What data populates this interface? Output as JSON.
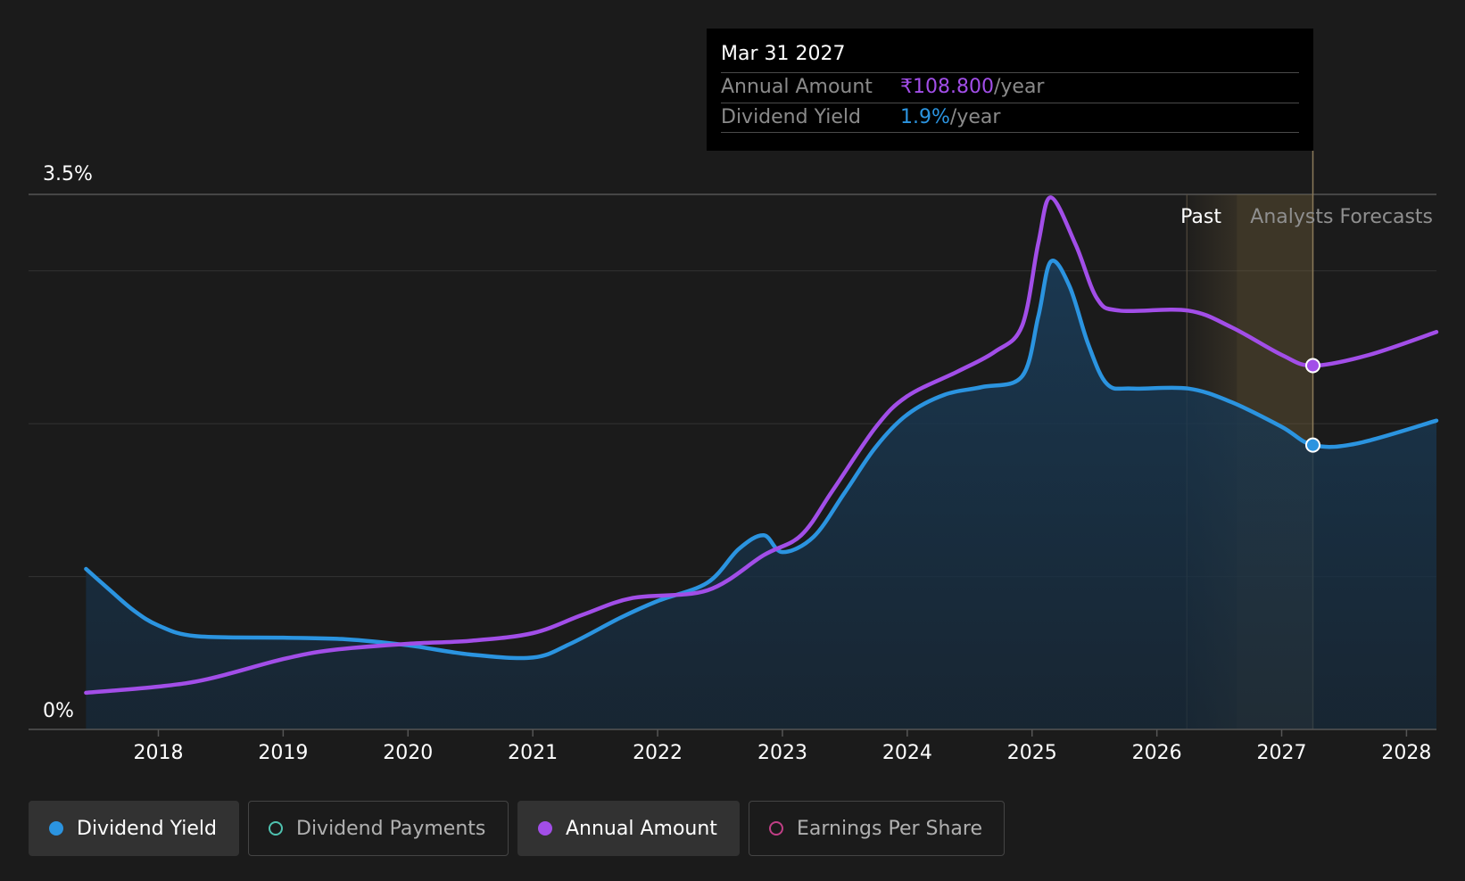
{
  "colors": {
    "dividend_yield": "#2b94e0",
    "annual_amount": "#a24ee8",
    "dividend_payments": "#4fc2b0",
    "earnings_per_share": "#c13f86",
    "forecast_band": "#6e5c3a",
    "background": "#1b1b1b"
  },
  "tooltip": {
    "date": "Mar 31 2027",
    "annual_amount_label": "Annual Amount",
    "annual_amount_value": "₹108.800",
    "annual_amount_unit": "/year",
    "dividend_yield_label": "Dividend Yield",
    "dividend_yield_value": "1.9%",
    "dividend_yield_unit": "/year"
  },
  "regions": {
    "past_label": "Past",
    "forecast_label": "Analysts Forecasts"
  },
  "legend": [
    {
      "label": "Dividend Yield",
      "active": true,
      "icon": "filled-dot-icon",
      "color": "#2b94e0"
    },
    {
      "label": "Dividend Payments",
      "active": false,
      "icon": "hollow-dot-icon",
      "color": "#4fc2b0"
    },
    {
      "label": "Annual Amount",
      "active": true,
      "icon": "filled-dot-icon",
      "color": "#a24ee8"
    },
    {
      "label": "Earnings Per Share",
      "active": false,
      "icon": "hollow-dot-icon",
      "color": "#c13f86"
    }
  ],
  "chart_data": {
    "type": "line",
    "y_tick_labels": [
      "3.5%",
      "0%"
    ],
    "ylim": [
      0,
      3.5
    ],
    "x_tick_labels": [
      "2018",
      "2019",
      "2020",
      "2021",
      "2022",
      "2023",
      "2024",
      "2025",
      "2026",
      "2027",
      "2028"
    ],
    "xlim": [
      2016.96,
      2028.24
    ],
    "grid": true,
    "forecast_band": [
      2026.24,
      2026.64,
      2027.25
    ],
    "highlight_x": 2027.25,
    "series": [
      {
        "name": "Dividend Yield",
        "color": "#2b94e0",
        "fill": true,
        "points": [
          [
            2017.42,
            1.05
          ],
          [
            2017.6,
            0.92
          ],
          [
            2017.8,
            0.78
          ],
          [
            2018.0,
            0.68
          ],
          [
            2018.3,
            0.61
          ],
          [
            2019.0,
            0.6
          ],
          [
            2019.5,
            0.59
          ],
          [
            2020.0,
            0.55
          ],
          [
            2020.5,
            0.49
          ],
          [
            2021.0,
            0.47
          ],
          [
            2021.3,
            0.56
          ],
          [
            2021.7,
            0.73
          ],
          [
            2022.0,
            0.84
          ],
          [
            2022.4,
            0.96
          ],
          [
            2022.65,
            1.18
          ],
          [
            2022.85,
            1.27
          ],
          [
            2023.0,
            1.16
          ],
          [
            2023.25,
            1.26
          ],
          [
            2023.5,
            1.55
          ],
          [
            2023.75,
            1.85
          ],
          [
            2024.0,
            2.06
          ],
          [
            2024.3,
            2.19
          ],
          [
            2024.6,
            2.24
          ],
          [
            2024.92,
            2.31
          ],
          [
            2025.05,
            2.7
          ],
          [
            2025.15,
            3.06
          ],
          [
            2025.3,
            2.9
          ],
          [
            2025.45,
            2.52
          ],
          [
            2025.6,
            2.26
          ],
          [
            2025.8,
            2.23
          ],
          [
            2026.25,
            2.23
          ],
          [
            2026.6,
            2.14
          ],
          [
            2027.0,
            1.98
          ],
          [
            2027.25,
            1.86
          ],
          [
            2027.6,
            1.87
          ],
          [
            2028.24,
            2.02
          ]
        ]
      },
      {
        "name": "Annual Amount",
        "color": "#a24ee8",
        "fill": false,
        "points": [
          [
            2017.42,
            0.24
          ],
          [
            2018.0,
            0.28
          ],
          [
            2018.4,
            0.33
          ],
          [
            2019.0,
            0.46
          ],
          [
            2019.4,
            0.52
          ],
          [
            2020.0,
            0.56
          ],
          [
            2020.5,
            0.58
          ],
          [
            2021.0,
            0.63
          ],
          [
            2021.4,
            0.75
          ],
          [
            2021.8,
            0.86
          ],
          [
            2022.4,
            0.91
          ],
          [
            2022.85,
            1.14
          ],
          [
            2023.15,
            1.27
          ],
          [
            2023.4,
            1.56
          ],
          [
            2023.75,
            1.98
          ],
          [
            2024.0,
            2.18
          ],
          [
            2024.4,
            2.34
          ],
          [
            2024.7,
            2.47
          ],
          [
            2024.92,
            2.64
          ],
          [
            2025.05,
            3.18
          ],
          [
            2025.15,
            3.48
          ],
          [
            2025.35,
            3.17
          ],
          [
            2025.52,
            2.82
          ],
          [
            2025.7,
            2.74
          ],
          [
            2026.25,
            2.74
          ],
          [
            2026.6,
            2.63
          ],
          [
            2027.0,
            2.45
          ],
          [
            2027.25,
            2.38
          ],
          [
            2027.7,
            2.45
          ],
          [
            2028.24,
            2.6
          ]
        ]
      }
    ]
  }
}
